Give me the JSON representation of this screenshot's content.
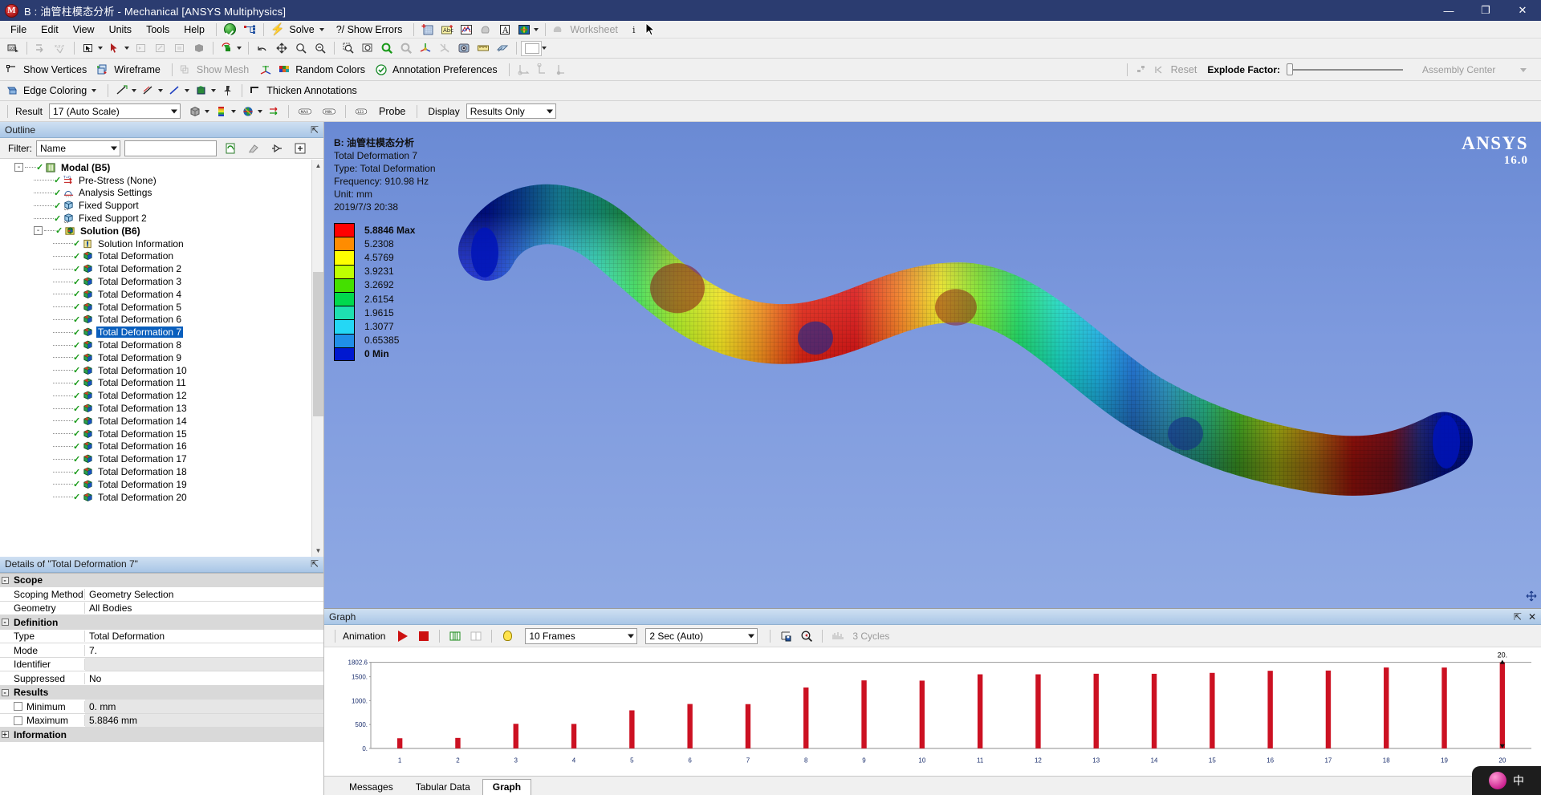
{
  "window": {
    "title": "B : 油管柱模态分析 - Mechanical [ANSYS Multiphysics]",
    "app_icon": "M",
    "minimize": "—",
    "maximize": "❐",
    "close": "✕"
  },
  "menu": {
    "items": [
      "File",
      "Edit",
      "View",
      "Units",
      "Tools",
      "Help"
    ],
    "solve_label": "Solve",
    "show_errors_label": "?/ Show Errors",
    "worksheet_label": "Worksheet"
  },
  "toolbar_display": {
    "show_vertices": "Show Vertices",
    "wireframe": "Wireframe",
    "show_mesh": "Show Mesh",
    "random_colors": "Random Colors",
    "annotation_preferences": "Annotation Preferences",
    "thicken_annotations": "Thicken Annotations",
    "reset": "Reset",
    "explode_factor": "Explode Factor:",
    "assembly_center": "Assembly Center"
  },
  "result_toolbar": {
    "result_label": "Result",
    "scale_value": "17 (Auto Scale)",
    "probe_label": "Probe",
    "display_label": "Display",
    "display_value": "Results Only"
  },
  "outline": {
    "title": "Outline",
    "filter_label": "Filter:",
    "filter_value": "Name",
    "search_value": "",
    "items": [
      {
        "label": "Modal (B5)",
        "depth": 0,
        "icon": "modal-icon",
        "bold": true,
        "expander": "-"
      },
      {
        "label": "Pre-Stress (None)",
        "depth": 1,
        "icon": "prestress-icon",
        "bold": false
      },
      {
        "label": "Analysis Settings",
        "depth": 1,
        "icon": "analysis-settings-icon",
        "bold": false
      },
      {
        "label": "Fixed Support",
        "depth": 1,
        "icon": "fixed-support-icon",
        "bold": false
      },
      {
        "label": "Fixed Support 2",
        "depth": 1,
        "icon": "fixed-support-icon",
        "bold": false
      },
      {
        "label": "Solution (B6)",
        "depth": 1,
        "icon": "solution-icon",
        "bold": true,
        "expander": "-"
      },
      {
        "label": "Solution Information",
        "depth": 2,
        "icon": "solution-info-icon",
        "bold": false
      },
      {
        "label": "Total Deformation",
        "depth": 2,
        "icon": "deformation-icon",
        "bold": false
      },
      {
        "label": "Total Deformation 2",
        "depth": 2,
        "icon": "deformation-icon",
        "bold": false
      },
      {
        "label": "Total Deformation 3",
        "depth": 2,
        "icon": "deformation-icon",
        "bold": false
      },
      {
        "label": "Total Deformation 4",
        "depth": 2,
        "icon": "deformation-icon",
        "bold": false
      },
      {
        "label": "Total Deformation 5",
        "depth": 2,
        "icon": "deformation-icon",
        "bold": false
      },
      {
        "label": "Total Deformation 6",
        "depth": 2,
        "icon": "deformation-icon",
        "bold": false
      },
      {
        "label": "Total Deformation 7",
        "depth": 2,
        "icon": "deformation-icon",
        "bold": false,
        "selected": true
      },
      {
        "label": "Total Deformation 8",
        "depth": 2,
        "icon": "deformation-icon",
        "bold": false
      },
      {
        "label": "Total Deformation 9",
        "depth": 2,
        "icon": "deformation-icon",
        "bold": false
      },
      {
        "label": "Total Deformation 10",
        "depth": 2,
        "icon": "deformation-icon",
        "bold": false
      },
      {
        "label": "Total Deformation 11",
        "depth": 2,
        "icon": "deformation-icon",
        "bold": false
      },
      {
        "label": "Total Deformation 12",
        "depth": 2,
        "icon": "deformation-icon",
        "bold": false
      },
      {
        "label": "Total Deformation 13",
        "depth": 2,
        "icon": "deformation-icon",
        "bold": false
      },
      {
        "label": "Total Deformation 14",
        "depth": 2,
        "icon": "deformation-icon",
        "bold": false
      },
      {
        "label": "Total Deformation 15",
        "depth": 2,
        "icon": "deformation-icon",
        "bold": false
      },
      {
        "label": "Total Deformation 16",
        "depth": 2,
        "icon": "deformation-icon",
        "bold": false
      },
      {
        "label": "Total Deformation 17",
        "depth": 2,
        "icon": "deformation-icon",
        "bold": false
      },
      {
        "label": "Total Deformation 18",
        "depth": 2,
        "icon": "deformation-icon",
        "bold": false
      },
      {
        "label": "Total Deformation 19",
        "depth": 2,
        "icon": "deformation-icon",
        "bold": false
      },
      {
        "label": "Total Deformation 20",
        "depth": 2,
        "icon": "deformation-icon",
        "bold": false
      }
    ]
  },
  "details": {
    "title": "Details of \"Total Deformation 7\"",
    "rows": [
      {
        "kind": "category",
        "key": "Scope",
        "expander": "-"
      },
      {
        "kind": "field",
        "key": "Scoping Method",
        "value": "Geometry Selection"
      },
      {
        "kind": "field",
        "key": "Geometry",
        "value": "All Bodies"
      },
      {
        "kind": "category",
        "key": "Definition",
        "expander": "-"
      },
      {
        "kind": "field",
        "key": "Type",
        "value": "Total Deformation"
      },
      {
        "kind": "field",
        "key": "Mode",
        "value": "7."
      },
      {
        "kind": "field",
        "key": "Identifier",
        "value": "",
        "readonly": true
      },
      {
        "kind": "field",
        "key": "Suppressed",
        "value": "No"
      },
      {
        "kind": "category",
        "key": "Results",
        "expander": "-"
      },
      {
        "kind": "check",
        "key": "Minimum",
        "value": "0. mm",
        "readonly": true
      },
      {
        "kind": "check",
        "key": "Maximum",
        "value": "5.8846 mm",
        "readonly": true
      },
      {
        "kind": "category",
        "key": "Information",
        "expander": "+"
      }
    ]
  },
  "viewport": {
    "annotation": [
      "B: 油管柱模态分析",
      "Total Deformation 7",
      "Type: Total Deformation",
      "Frequency: 910.98 Hz",
      "Unit: mm",
      "2019/7/3 20:38"
    ],
    "logo_main": "ANSYS",
    "logo_version": "16.0",
    "legend": [
      {
        "label": "5.8846 Max",
        "color": "#ff0000",
        "bold": true
      },
      {
        "label": "5.2308",
        "color": "#ff8c00",
        "bold": false
      },
      {
        "label": "4.5769",
        "color": "#ffff00",
        "bold": false
      },
      {
        "label": "3.9231",
        "color": "#bfff00",
        "bold": false
      },
      {
        "label": "3.2692",
        "color": "#44e000",
        "bold": false
      },
      {
        "label": "2.6154",
        "color": "#00d94d",
        "bold": false
      },
      {
        "label": "1.9615",
        "color": "#1ee0b0",
        "bold": false
      },
      {
        "label": "1.3077",
        "color": "#24d7f5",
        "bold": false
      },
      {
        "label": "0.65385",
        "color": "#1f8fe8",
        "bold": false
      },
      {
        "label": "0 Min",
        "color": "#0018d0",
        "bold": true
      }
    ]
  },
  "graph": {
    "title": "Graph",
    "pin": "⇱",
    "close": "✕",
    "animation_label": "Animation",
    "frames_value": "10 Frames",
    "duration_value": "2 Sec (Auto)",
    "cycles_label": "3 Cycles",
    "tabs": [
      {
        "label": "Messages",
        "active": false
      },
      {
        "label": "Tabular Data",
        "active": false
      },
      {
        "label": "Graph",
        "active": true
      }
    ]
  },
  "chart_data": {
    "type": "bar",
    "title": "",
    "xlabel": "",
    "ylabel": "",
    "categories": [
      "1",
      "2",
      "3",
      "4",
      "5",
      "6",
      "7",
      "8",
      "9",
      "10",
      "11",
      "12",
      "13",
      "14",
      "15",
      "16",
      "17",
      "18",
      "19",
      "20"
    ],
    "values": [
      213,
      220,
      515,
      513,
      797,
      930,
      927,
      1275,
      1424,
      1419,
      1551,
      1551,
      1563,
      1562,
      1581,
      1625,
      1630,
      1694,
      1693,
      1802.6
    ],
    "ytick_labels": [
      "1802.6",
      "1500.",
      "1000.",
      "500.",
      "0."
    ],
    "yticks": [
      1802.6,
      1500,
      1000,
      500,
      0
    ],
    "ylim": [
      0,
      1802.6
    ],
    "bar_color": "#cc1122",
    "grid": false,
    "legend": "none",
    "annotations": [
      {
        "text": "20.",
        "x": "20",
        "y": 1802.6
      }
    ]
  },
  "ime": {
    "lang": "中"
  }
}
